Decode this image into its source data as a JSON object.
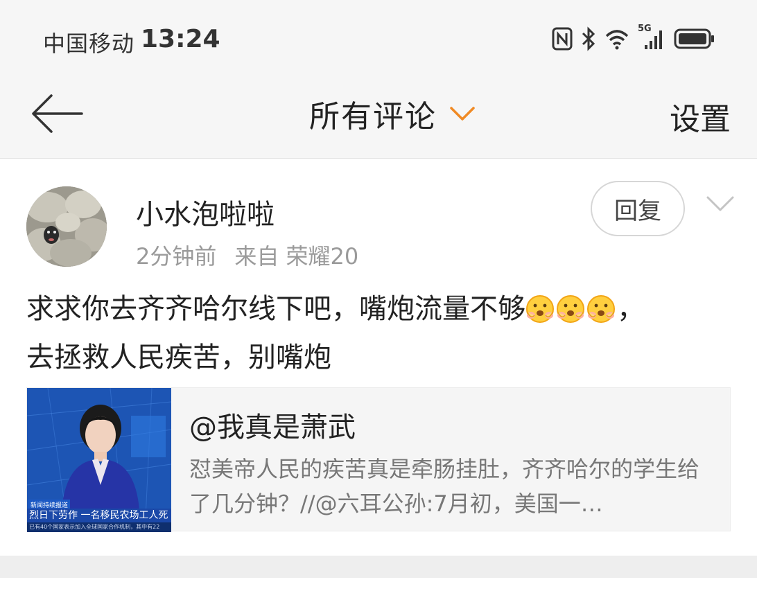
{
  "status_bar": {
    "carrier": "中国移动",
    "time": "13:24",
    "network": "5G",
    "icons": [
      "nfc-icon",
      "bluetooth-icon",
      "wifi-icon",
      "cellular-signal-icon",
      "battery-icon"
    ]
  },
  "nav": {
    "title": "所有评论",
    "settings_label": "设置",
    "accent_color": "#f08a24"
  },
  "comment": {
    "username": "小水泡啦啦",
    "time_ago": "2分钟前",
    "source": "来自 荣耀20",
    "reply_label": "回复",
    "text_part1": "求求你去齐齐哈尔线下吧，嘴炮流量不够",
    "emoji_names": [
      "face-emoji",
      "face-emoji",
      "face-emoji"
    ],
    "text_part2": "，",
    "text_line2": "去拯救人民疾苦，别嘴炮"
  },
  "quote": {
    "author": "@我真是萧武",
    "body": "怼美帝人民的疾苦真是牵肠挂肚，齐齐哈尔的学生给了几分钟？//@六耳公孙:7月初，美国一…",
    "thumbnail": {
      "label": "新闻持续报道",
      "banner": "烈日下劳作 一名移民农场工人死",
      "ticker": "已有40个国家表示加入全球国家合作机制，其中有22"
    }
  }
}
